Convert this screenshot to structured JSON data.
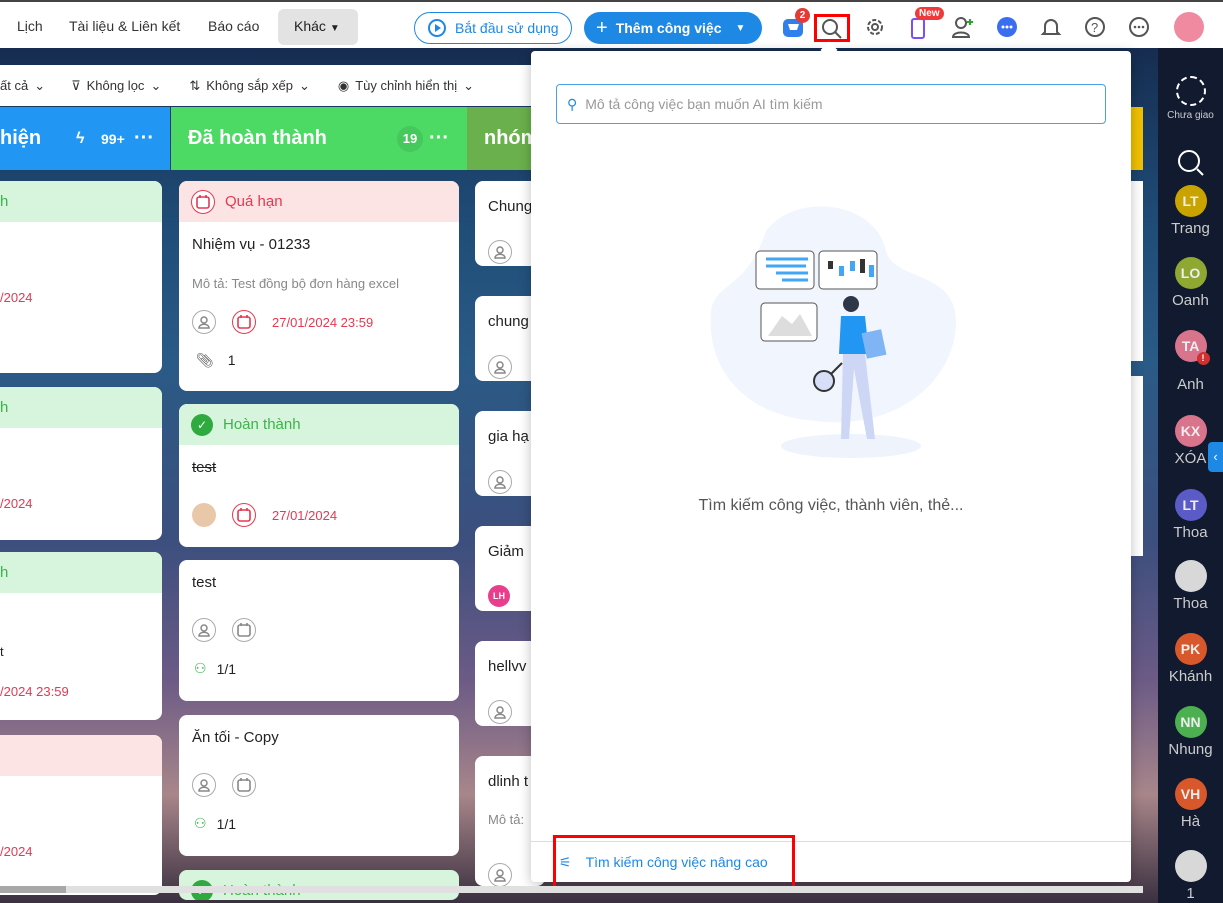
{
  "topbar": {
    "nav": [
      "Lịch",
      "Tài liệu & Liên kết",
      "Báo cáo"
    ],
    "more": "Khác",
    "start": "Bắt đầu sử dụng",
    "add_task": "Thêm công việc",
    "cart_badge": "2",
    "new_badge": "New"
  },
  "toolbar": {
    "all": "ất cả",
    "filter": "Không lọc",
    "sort": "Không sắp xếp",
    "display": "Tùy chỉnh hiển thị"
  },
  "columns": [
    {
      "title": "hiện",
      "count": "99+",
      "color": "#2196f3"
    },
    {
      "title": "Đã hoàn thành",
      "count": "19",
      "color": "#4cd964"
    },
    {
      "title": "nhóm",
      "color": "#6ab04c"
    }
  ],
  "col1_cards": [
    {
      "status": "h",
      "date": "/2024"
    },
    {
      "status": "h",
      "date": "/2024"
    },
    {
      "status": "h",
      "extra": "t",
      "date": "/2024 23:59"
    },
    {
      "status": "",
      "date": "/2024"
    }
  ],
  "col2_cards": [
    {
      "status": "Quá hạn",
      "title": "Nhiệm vụ - 01233",
      "desc": "Mô tả: Test đồng bộ đơn hàng excel",
      "date": "27/01/2024 23:59",
      "attachments": "1"
    },
    {
      "status": "Hoàn thành",
      "title": "test",
      "date": "27/01/2024"
    },
    {
      "title": "test",
      "subtasks": "1/1"
    },
    {
      "title": "Ăn tối - Copy",
      "subtasks": "1/1"
    },
    {
      "status": "Hoàn thành"
    }
  ],
  "col3_cards": [
    {
      "title": "Chung"
    },
    {
      "title": "chung"
    },
    {
      "title": "gia hạ"
    },
    {
      "title": "Giảm",
      "assignee": "LH"
    },
    {
      "title": "hellvv"
    },
    {
      "title": "dlinh t",
      "desc": "Mô tả:"
    }
  ],
  "popup": {
    "placeholder": "Mô tả công việc bạn muốn AI tìm kiếm",
    "empty_text": "Tìm kiếm công việc, thành viên, thẻ...",
    "advanced": "Tìm kiếm công việc nâng cao"
  },
  "sidebar": {
    "unassigned": "Chưa giao",
    "members": [
      {
        "initials": "LT",
        "name": "Trang",
        "color": "#c9a400"
      },
      {
        "initials": "LO",
        "name": "Oanh",
        "color": "#8fa832"
      },
      {
        "initials": "TA",
        "name": "Anh",
        "color": "#d9748d",
        "alert": "!"
      },
      {
        "initials": "KX",
        "name": "XÓA",
        "color": "#d9748d"
      },
      {
        "initials": "LT",
        "name": "Thoa",
        "color": "#5b5bc8"
      },
      {
        "initials": "",
        "name": "Thoa",
        "color": "#d8d8d8"
      },
      {
        "initials": "PK",
        "name": "Khánh",
        "color": "#d9582b"
      },
      {
        "initials": "NN",
        "name": "Nhung",
        "color": "#4caf50"
      },
      {
        "initials": "VH",
        "name": "Hà",
        "color": "#d9582b"
      },
      {
        "initials": "",
        "name": "1",
        "color": "#d8d8d8"
      }
    ]
  }
}
